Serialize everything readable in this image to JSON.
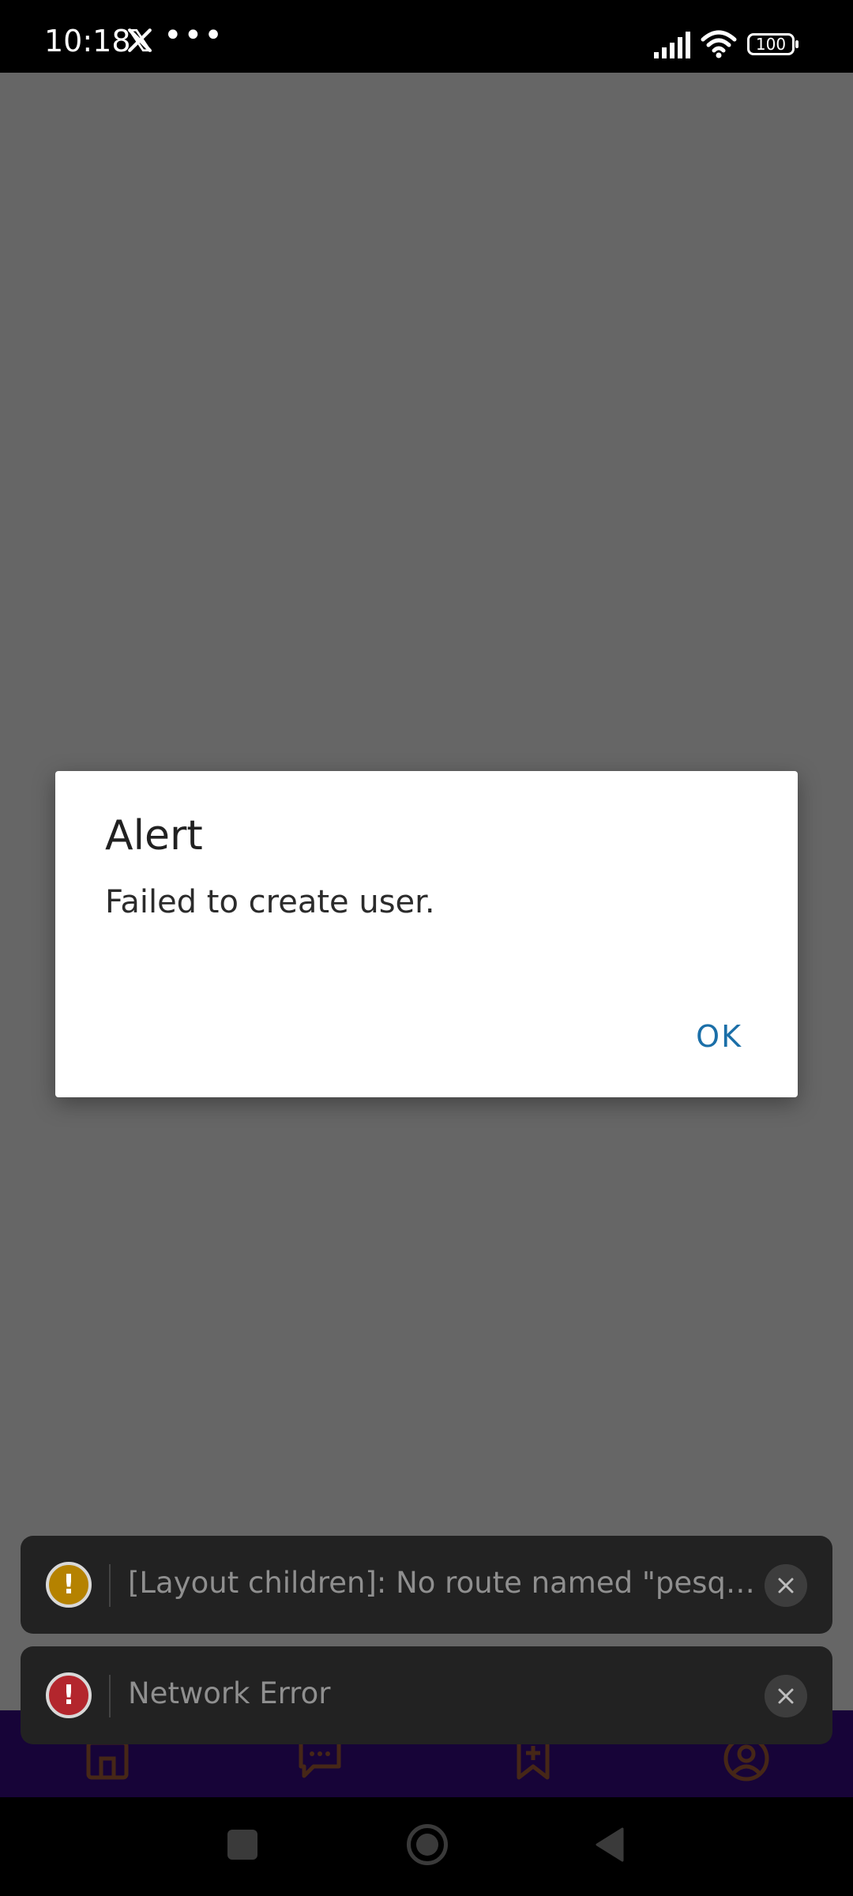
{
  "status_bar": {
    "time": "10:18",
    "notification_icons": [
      "x-logo-icon",
      "more-dots-icon"
    ],
    "dots": "•••",
    "battery": "100",
    "system_icons": [
      "signal-icon",
      "wifi-icon",
      "battery-icon"
    ]
  },
  "bottom_tabs": {
    "icons": [
      "home-icon",
      "chat-icon",
      "bookmark-add-icon",
      "profile-icon"
    ],
    "background_color": "#3a0a8c",
    "icon_color": "#b0623a"
  },
  "dialog": {
    "title": "Alert",
    "message": "Failed to create user.",
    "ok_label": "OK",
    "ok_color": "#1b6fa8"
  },
  "toasts": [
    {
      "type": "warning",
      "icon": "exclamation-icon",
      "badge": "!",
      "text": "[Layout children]: No route named \"pesquisa…",
      "color": "#b58200"
    },
    {
      "type": "error",
      "icon": "exclamation-icon",
      "badge": "!",
      "text": "Network Error",
      "color": "#b3262d"
    }
  ],
  "nav_bar": {
    "buttons": [
      "recents-button",
      "home-button",
      "back-button"
    ]
  }
}
